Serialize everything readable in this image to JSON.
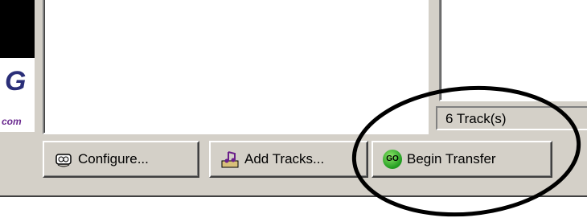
{
  "logo": {
    "mark": "G",
    "domain_text": "com"
  },
  "status": {
    "track_count": "6 Track(s)"
  },
  "buttons": {
    "configure": "Configure...",
    "add_tracks": "Add Tracks...",
    "begin_transfer": "Begin Transfer",
    "go_badge": "GO"
  },
  "icons": {
    "configure": "configure-icon",
    "add_tracks": "add-tracks-icon",
    "begin_transfer": "go-icon"
  },
  "annotation": {
    "shape": "hand-drawn-ellipse",
    "color": "#000000"
  }
}
